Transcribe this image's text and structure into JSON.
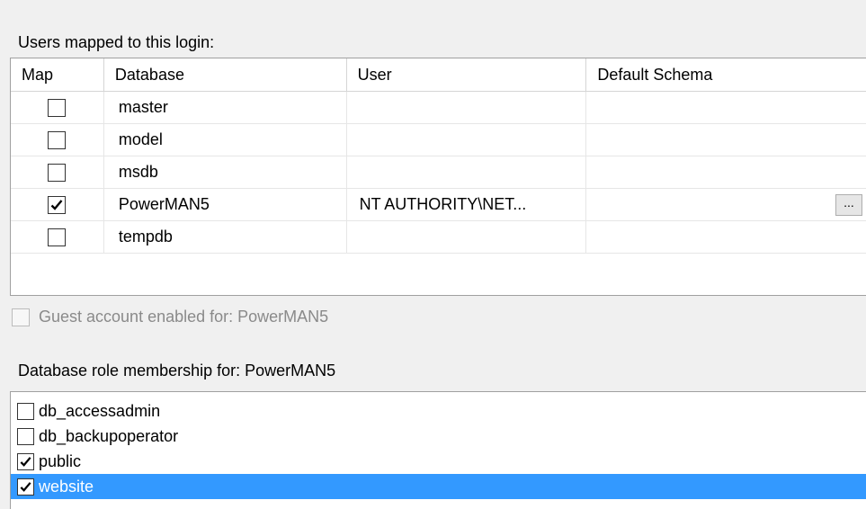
{
  "users_section": {
    "label": "Users mapped to this login:",
    "columns": [
      "Map",
      "Database",
      "User",
      "Default Schema"
    ],
    "rows": [
      {
        "mapped": false,
        "database": "master",
        "user": "",
        "default_schema": ""
      },
      {
        "mapped": false,
        "database": "model",
        "user": "",
        "default_schema": ""
      },
      {
        "mapped": false,
        "database": "msdb",
        "user": "",
        "default_schema": ""
      },
      {
        "mapped": true,
        "database": "PowerMAN5",
        "user": "NT AUTHORITY\\NET...",
        "default_schema": "",
        "browse_label": "..."
      },
      {
        "mapped": false,
        "database": "tempdb",
        "user": "",
        "default_schema": ""
      }
    ]
  },
  "guest": {
    "label": "Guest account enabled for: PowerMAN5",
    "checked": false,
    "enabled": false
  },
  "roles_section": {
    "label": "Database role membership for: PowerMAN5",
    "items": [
      {
        "label": "db_accessadmin",
        "checked": false,
        "selected": false
      },
      {
        "label": "db_backupoperator",
        "checked": false,
        "selected": false
      },
      {
        "label": "public",
        "checked": true,
        "selected": false
      },
      {
        "label": "website",
        "checked": true,
        "selected": true
      }
    ]
  },
  "colors": {
    "selection": "#3399ff",
    "background": "#f0f0f0"
  }
}
